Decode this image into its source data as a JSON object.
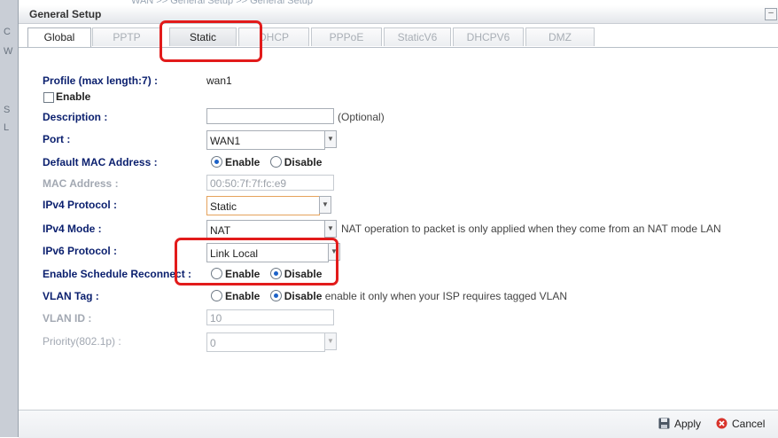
{
  "breadcrumb": "WAN >> General Setup >> General Setup",
  "dialog": {
    "title": "General Setup",
    "minimize_label": "–"
  },
  "tabs": [
    "Global",
    "PPTP",
    "Static",
    "DHCP",
    "PPPoE",
    "StaticV6",
    "DHCPV6",
    "DMZ"
  ],
  "active_tab": "Global",
  "selected_tab": "Static",
  "form": {
    "profile": {
      "label": "Profile (max length:7) :",
      "value": "wan1"
    },
    "enable": {
      "label": "Enable",
      "checked": false
    },
    "description": {
      "label": "Description :",
      "value": "",
      "hint": "(Optional)"
    },
    "port": {
      "label": "Port :",
      "value": "WAN1"
    },
    "default_mac": {
      "label": "Default MAC Address :",
      "options": [
        "Enable",
        "Disable"
      ],
      "selected": "Enable"
    },
    "mac_address": {
      "label": "MAC Address :",
      "value": "00:50:7f:7f:fc:e9"
    },
    "ipv4_protocol": {
      "label": "IPv4 Protocol :",
      "value": "Static"
    },
    "ipv4_mode": {
      "label": "IPv4 Mode :",
      "value": "NAT",
      "hint": "NAT operation to packet is only applied when they come from an NAT mode LAN"
    },
    "ipv6_protocol": {
      "label": "IPv6 Protocol :",
      "value": "Link Local"
    },
    "schedule_reconnect": {
      "label": "Enable Schedule Reconnect :",
      "options": [
        "Enable",
        "Disable"
      ],
      "selected": "Disable"
    },
    "vlan_tag": {
      "label": "VLAN Tag :",
      "options": [
        "Enable",
        "Disable"
      ],
      "selected": "Disable",
      "hint": "enable it only when your ISP requires tagged VLAN"
    },
    "vlan_id": {
      "label": "VLAN ID :",
      "value": "10"
    },
    "priority": {
      "label": "Priority(802.1p) :",
      "value": "0"
    }
  },
  "footer": {
    "apply_label": "Apply",
    "cancel_label": "Cancel"
  },
  "colors": {
    "label": "#0a1f6e",
    "highlight": "#e21b1b",
    "radio_dot": "#1d62c8"
  }
}
